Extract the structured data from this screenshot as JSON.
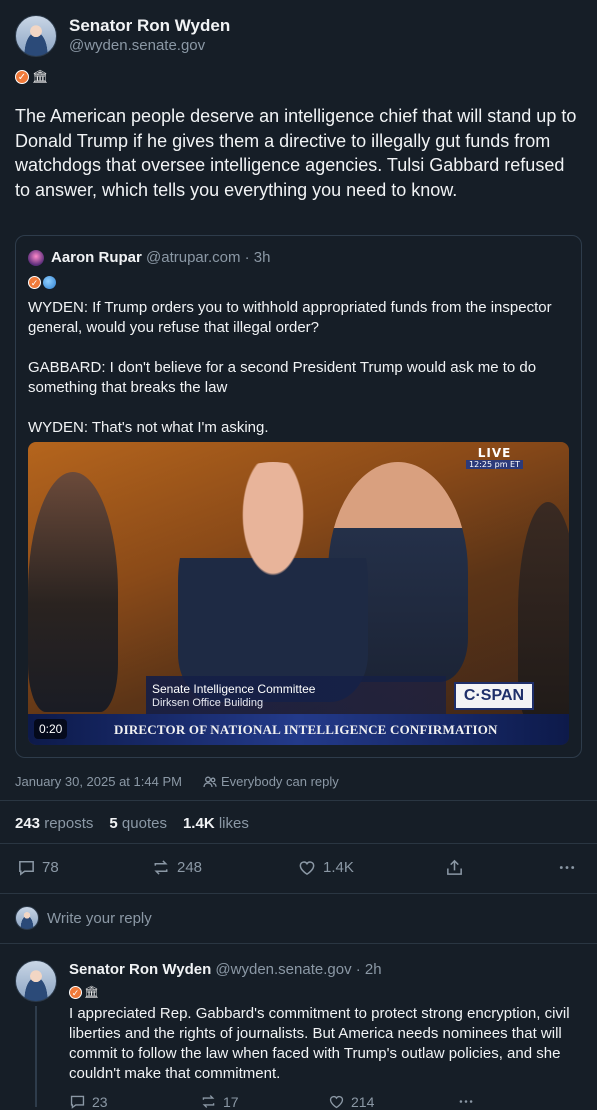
{
  "post": {
    "author_name": "Senator Ron Wyden",
    "author_handle": "@wyden.senate.gov",
    "badges": [
      "verified-badge-icon",
      "government-building-icon"
    ],
    "text": "The American people deserve an intelligence chief that will stand up to Donald Trump if he gives them a directive to illegally gut funds from watchdogs that oversee intelligence agencies. Tulsi Gabbard refused to answer, which tells you everything you need to know.",
    "date": "January 30, 2025 at 1:44 PM",
    "reply_setting": "Everybody can reply"
  },
  "quote": {
    "author_name": "Aaron Rupar",
    "author_handle": "@atrupar.com",
    "age": "· 3h",
    "text": "WYDEN: If Trump orders you to withhold appropriated funds from the inspector general, would you refuse that illegal order?\n\nGABBARD: I don't believe for a second President Trump would ask me to do something that breaks the law\n\nWYDEN: That's not what I'm asking.",
    "video": {
      "live_label": "LIVE",
      "live_time": "12:25 pm ET",
      "committee": "Senate Intelligence Committee",
      "building": "Dirksen Office Building",
      "network": "C·SPAN",
      "headline": "DIRECTOR OF NATIONAL INTELLIGENCE CONFIRMATION",
      "duration": "0:20"
    }
  },
  "stats": {
    "reposts_count": "243",
    "reposts_label": "reposts",
    "quotes_count": "5",
    "quotes_label": "quotes",
    "likes_count": "1.4K",
    "likes_label": "likes"
  },
  "actions": {
    "replies": "78",
    "reposts": "248",
    "likes": "1.4K"
  },
  "reply_box": {
    "placeholder": "Write your reply"
  },
  "reply": {
    "author_name": "Senator Ron Wyden",
    "author_handle": "@wyden.senate.gov",
    "age": "· 2h",
    "text": "I appreciated Rep. Gabbard's commitment to protect strong encryption, civil liberties and the rights of journalists. But America needs nominees that will commit to follow the law when faced with Trump's outlaw policies, and she couldn't make that commitment.",
    "replies": "23",
    "reposts": "17",
    "likes": "214"
  },
  "colors": {
    "background": "#161e27",
    "text": "#f1f3f5",
    "muted": "#8b98a5",
    "border": "#2e3c4b"
  }
}
